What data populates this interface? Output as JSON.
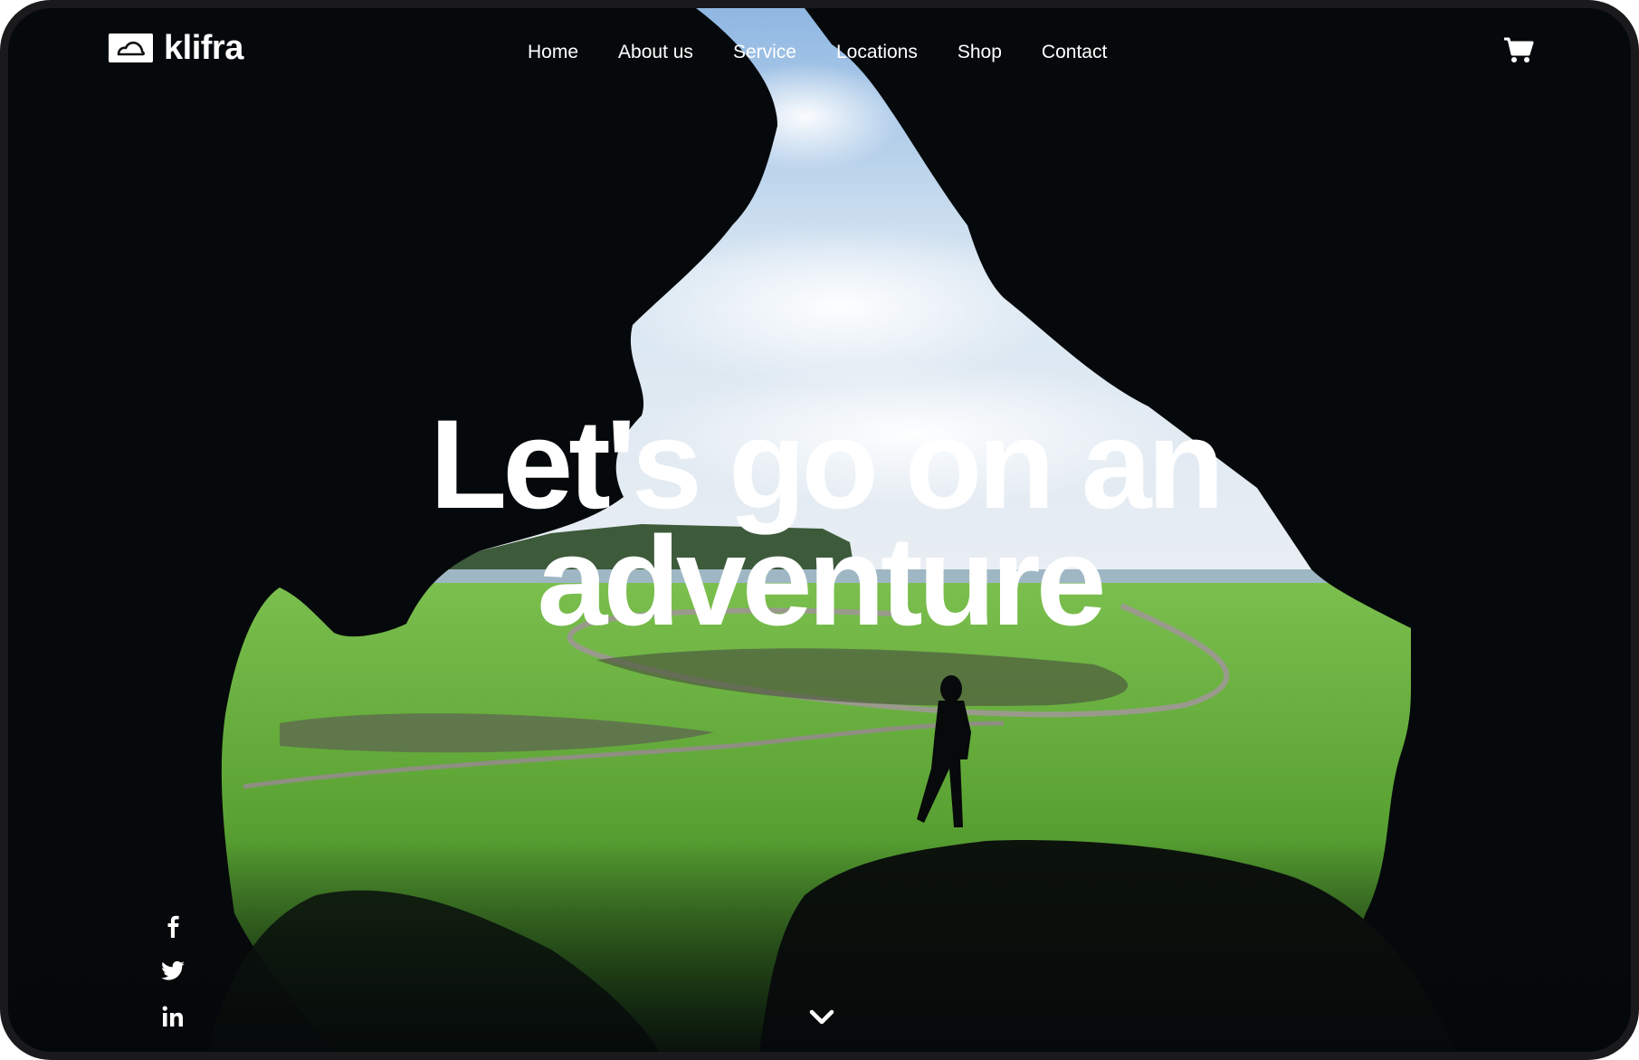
{
  "brand": {
    "name": "klifra",
    "logo_icon": "cloud-icon"
  },
  "nav": {
    "items": [
      {
        "label": "Home"
      },
      {
        "label": "About us"
      },
      {
        "label": "Service"
      },
      {
        "label": "Locations"
      },
      {
        "label": "Shop"
      },
      {
        "label": "Contact"
      }
    ]
  },
  "header": {
    "cart_icon": "shopping-cart-icon"
  },
  "hero": {
    "line1": "Let's go on an",
    "line2": "adventure"
  },
  "social": {
    "items": [
      {
        "icon": "facebook-icon"
      },
      {
        "icon": "twitter-icon"
      },
      {
        "icon": "linkedin-icon"
      }
    ]
  },
  "scroll": {
    "icon": "chevron-down-icon"
  },
  "colors": {
    "text": "#ffffff",
    "cave": "#05080a",
    "grass": "#5aa233",
    "sky": "#b9d6ee"
  }
}
